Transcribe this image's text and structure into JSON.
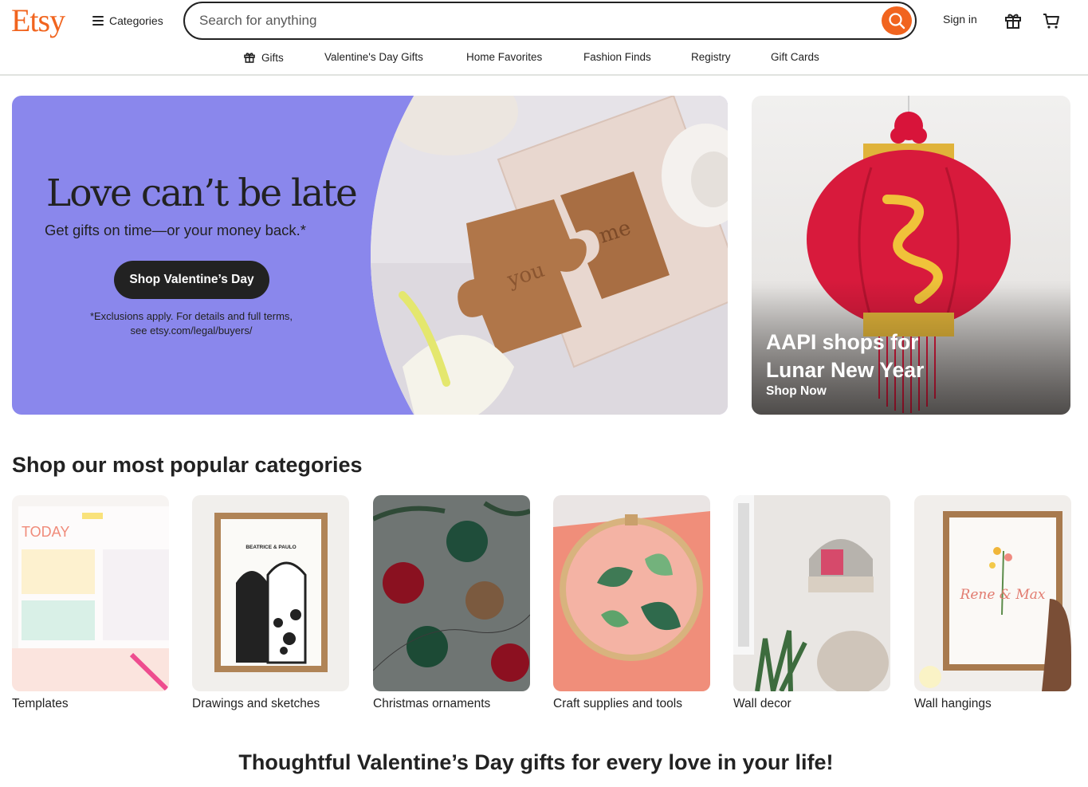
{
  "header": {
    "logo": "Etsy",
    "categories_label": "Categories",
    "search_placeholder": "Search for anything",
    "signin_label": "Sign in"
  },
  "subnav": {
    "items": [
      {
        "label": "Gifts",
        "icon": "gift-icon"
      },
      {
        "label": "Valentine's Day Gifts"
      },
      {
        "label": "Home Favorites"
      },
      {
        "label": "Fashion Finds"
      },
      {
        "label": "Registry"
      },
      {
        "label": "Gift Cards"
      }
    ]
  },
  "hero": {
    "title": "Love can’t be late",
    "subtitle": "Get gifts on time—or your money back.*",
    "button": "Shop Valentine’s Day",
    "fine_print": "*Exclusions apply. For details and full terms, see etsy.com/legal/buyers/",
    "puzzle_words": [
      "you",
      "me"
    ],
    "background_color": "#8a87ec"
  },
  "promo": {
    "title": "AAPI shops for Lunar New Year",
    "link": "Shop Now"
  },
  "categories": {
    "title": "Shop our most popular categories",
    "items": [
      {
        "label": "Templates",
        "image_text": "TODAY"
      },
      {
        "label": "Drawings and sketches",
        "image_text": "BEATRICE & PAULO"
      },
      {
        "label": "Christmas ornaments"
      },
      {
        "label": "Craft supplies and tools"
      },
      {
        "label": "Wall decor"
      },
      {
        "label": "Wall hangings",
        "image_text": "Rene & Max"
      }
    ]
  },
  "bottom_title": "Thoughtful Valentine’s Day gifts for every love in your life!",
  "colors": {
    "brand": "#f1641e",
    "dark": "#222222"
  }
}
